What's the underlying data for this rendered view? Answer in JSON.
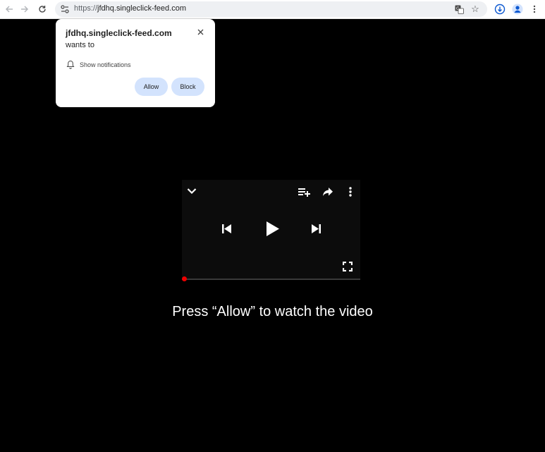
{
  "browser": {
    "url_scheme": "https://",
    "url_host": "jfdhq.singleclick-feed.com"
  },
  "permission_prompt": {
    "site": "jfdhq.singleclick-feed.com",
    "wants_to": "wants to",
    "permission": "Show notifications",
    "allow_label": "Allow",
    "block_label": "Block"
  },
  "player": {
    "progress": 0
  },
  "page": {
    "caption": "Press “Allow” to watch the video"
  },
  "colors": {
    "accent_button": "#d3e3fd",
    "progress_dot": "#ee0000",
    "background": "#000000"
  }
}
